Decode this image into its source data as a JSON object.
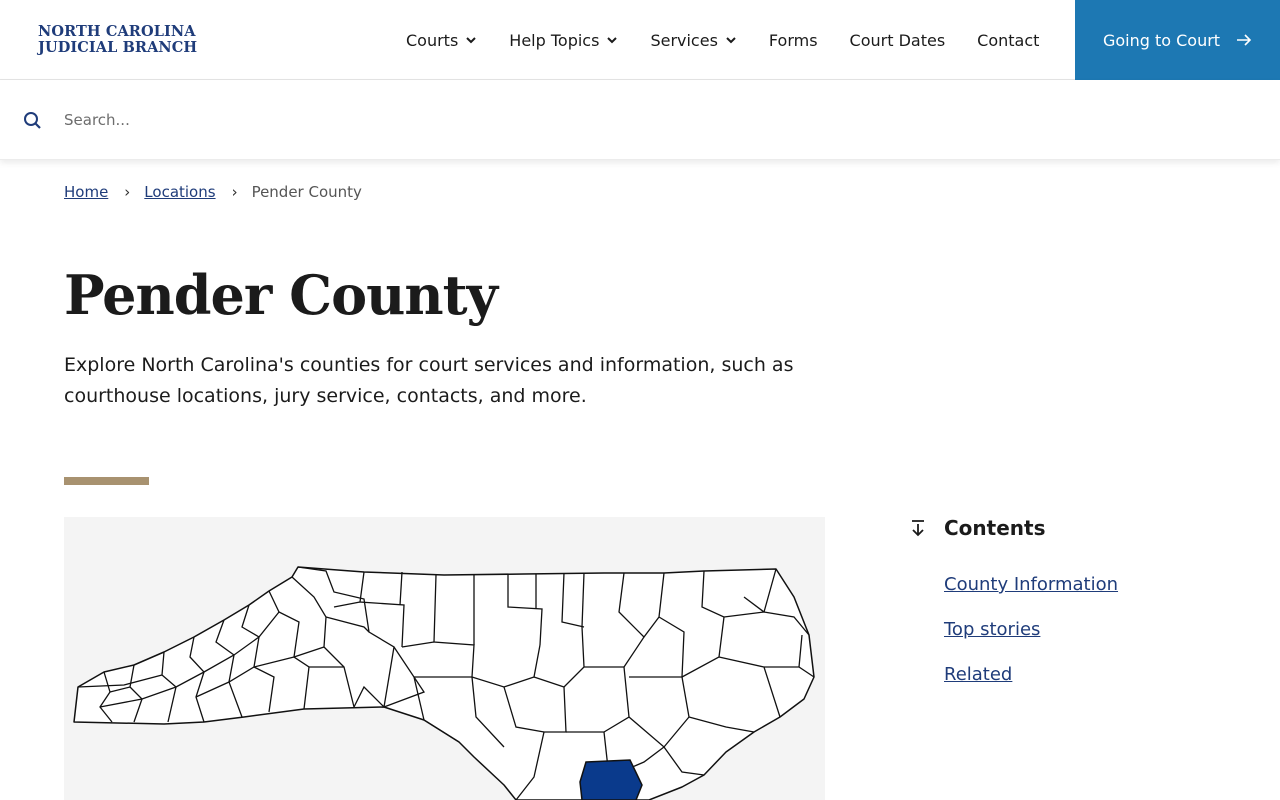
{
  "header": {
    "logo_line1": "NORTH CAROLINA",
    "logo_line2": "JUDICIAL BRANCH",
    "nav": [
      {
        "label": "Courts",
        "has_dropdown": true
      },
      {
        "label": "Help Topics",
        "has_dropdown": true
      },
      {
        "label": "Services",
        "has_dropdown": true
      },
      {
        "label": "Forms",
        "has_dropdown": false
      },
      {
        "label": "Court Dates",
        "has_dropdown": false
      },
      {
        "label": "Contact",
        "has_dropdown": false
      }
    ],
    "cta_label": "Going to Court",
    "cta_color": "#1d78b3"
  },
  "search": {
    "placeholder": "Search..."
  },
  "breadcrumb": {
    "items": [
      {
        "label": "Home"
      },
      {
        "label": "Locations"
      }
    ],
    "current": "Pender County"
  },
  "page": {
    "title": "Pender County",
    "intro": "Explore North Carolina's counties for court services and information, such as courthouse locations, jury service, contacts, and more.",
    "accent_color": "#a89270"
  },
  "map": {
    "highlighted_county": "Pender",
    "highlight_color": "#0a3a8c"
  },
  "contents": {
    "heading": "Contents",
    "links": [
      {
        "label": "County Information"
      },
      {
        "label": "Top stories"
      },
      {
        "label": "Related"
      }
    ]
  }
}
